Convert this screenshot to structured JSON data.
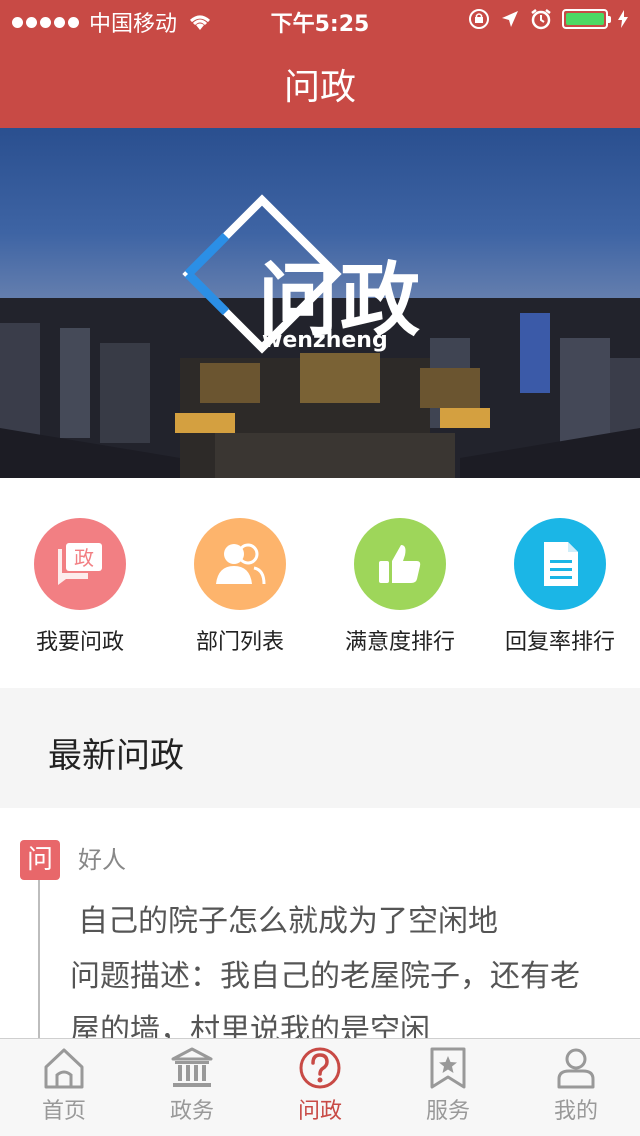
{
  "status_bar": {
    "carrier": "中国移动",
    "time": "下午5:25",
    "battery_color": "#4cd964"
  },
  "header": {
    "title": "问政",
    "background": "#c84a45"
  },
  "banner": {
    "logo_text": "问政",
    "logo_subtext": "wenzheng"
  },
  "quick_actions": [
    {
      "label": "我要问政",
      "icon": "chat-zheng-icon",
      "color": "#f27f83"
    },
    {
      "label": "部门列表",
      "icon": "people-icon",
      "color": "#fdb46c"
    },
    {
      "label": "满意度排行",
      "icon": "thumbs-up-icon",
      "color": "#9ed65a"
    },
    {
      "label": "回复率排行",
      "icon": "document-icon",
      "color": "#1bb6e6"
    }
  ],
  "section": {
    "title": "最新问政"
  },
  "feed": {
    "badge": "问",
    "author": "好人",
    "post_title": "自己的院子怎么就成为了空闲地",
    "post_desc": "问题描述：我自己的老屋院子，还有老屋的墙，村里说我的是空闲"
  },
  "tabbar": {
    "active_color": "#c84a45",
    "inactive_color": "#999999",
    "tabs": [
      {
        "label": "首页",
        "icon": "home-icon"
      },
      {
        "label": "政务",
        "icon": "bank-icon"
      },
      {
        "label": "问政",
        "icon": "question-icon"
      },
      {
        "label": "服务",
        "icon": "bookmark-star-icon"
      },
      {
        "label": "我的",
        "icon": "user-icon"
      }
    ]
  }
}
